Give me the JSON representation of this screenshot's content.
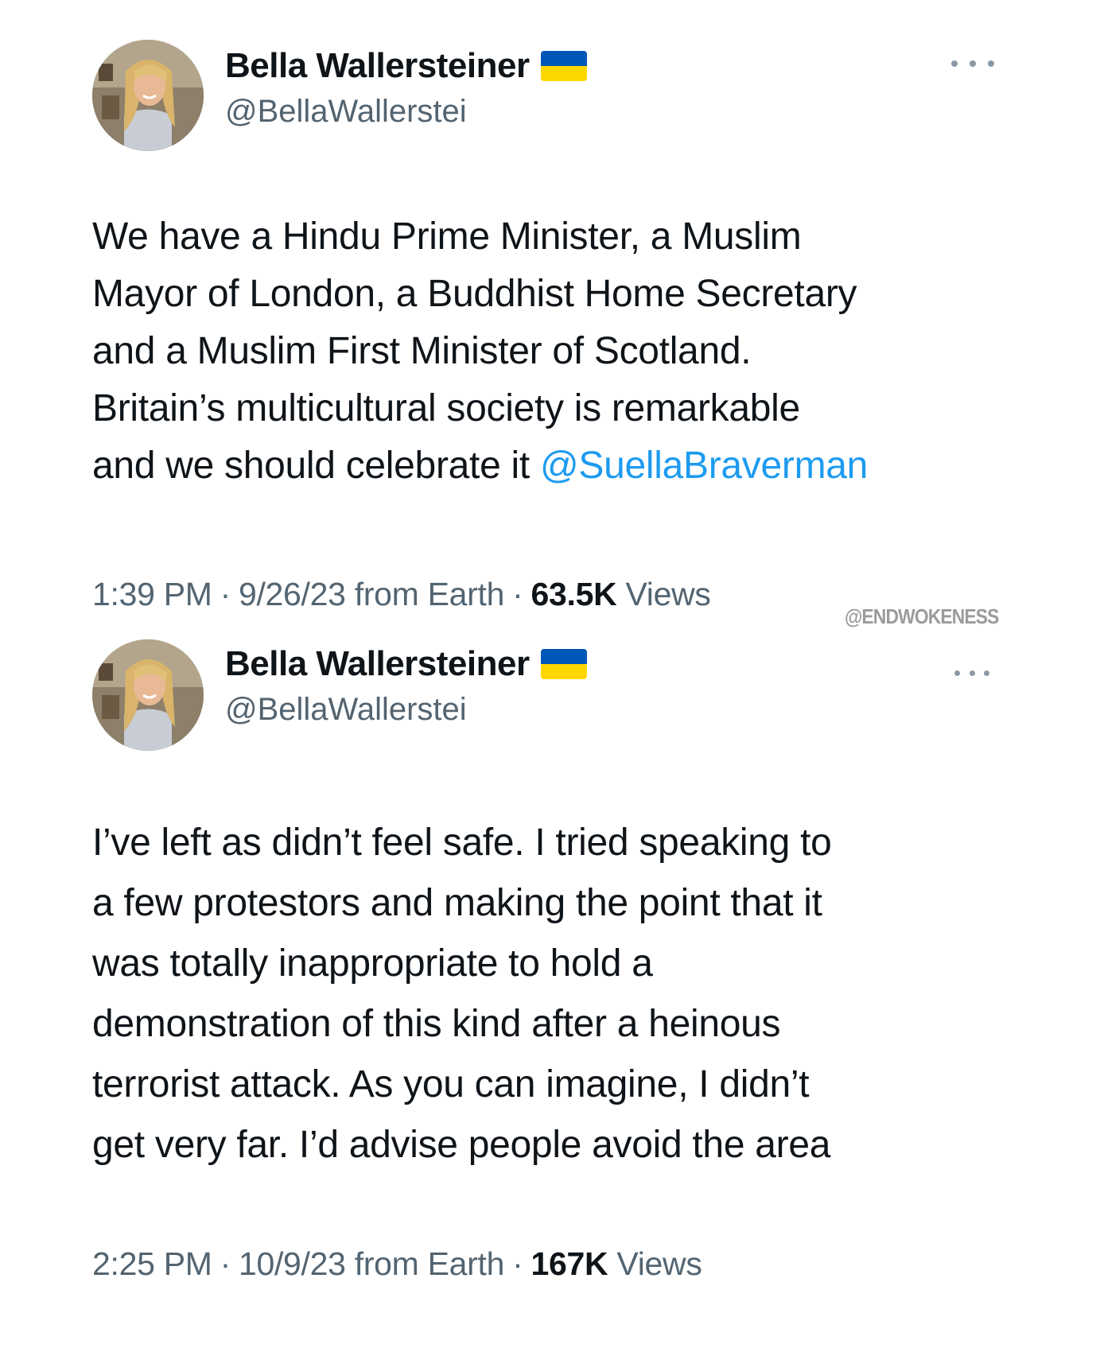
{
  "watermark": "@ENDWOKENESS",
  "tweets": [
    {
      "author": {
        "display_name": "Bella Wallersteiner",
        "handle": "@BellaWallerstei",
        "flag_icon": "ukraine-flag-icon"
      },
      "text_lines": [
        "We have a Hindu Prime Minister, a Muslim",
        "Mayor of London, a Buddhist Home Secretary",
        "and a Muslim First Minister of Scotland.",
        "Britain’s multicultural society is remarkable",
        "and we should celebrate it "
      ],
      "mention": "@SuellaBraverman",
      "time": "1:39 PM",
      "date": "9/26/23 from Earth",
      "views_count": "63.5K",
      "views_label": "Views"
    },
    {
      "author": {
        "display_name": "Bella Wallersteiner",
        "handle": "@BellaWallerstei",
        "flag_icon": "ukraine-flag-icon"
      },
      "text_lines": [
        "I’ve left as didn’t feel safe. I tried speaking to",
        "a few protestors and making the point that it",
        "was totally inappropriate to hold a",
        "demonstration of this kind after a heinous",
        "terrorist attack. As you can imagine, I didn’t",
        "get very far. I’d advise people avoid the area"
      ],
      "time": "2:25 PM",
      "date": "10/9/23 from Earth",
      "views_count": "167K",
      "views_label": "Views"
    }
  ],
  "colors": {
    "text_primary": "#0f1419",
    "text_secondary": "#536471",
    "mention_blue": "#1d9bf0",
    "flag_blue": "#0057b7",
    "flag_yellow": "#ffd700"
  }
}
